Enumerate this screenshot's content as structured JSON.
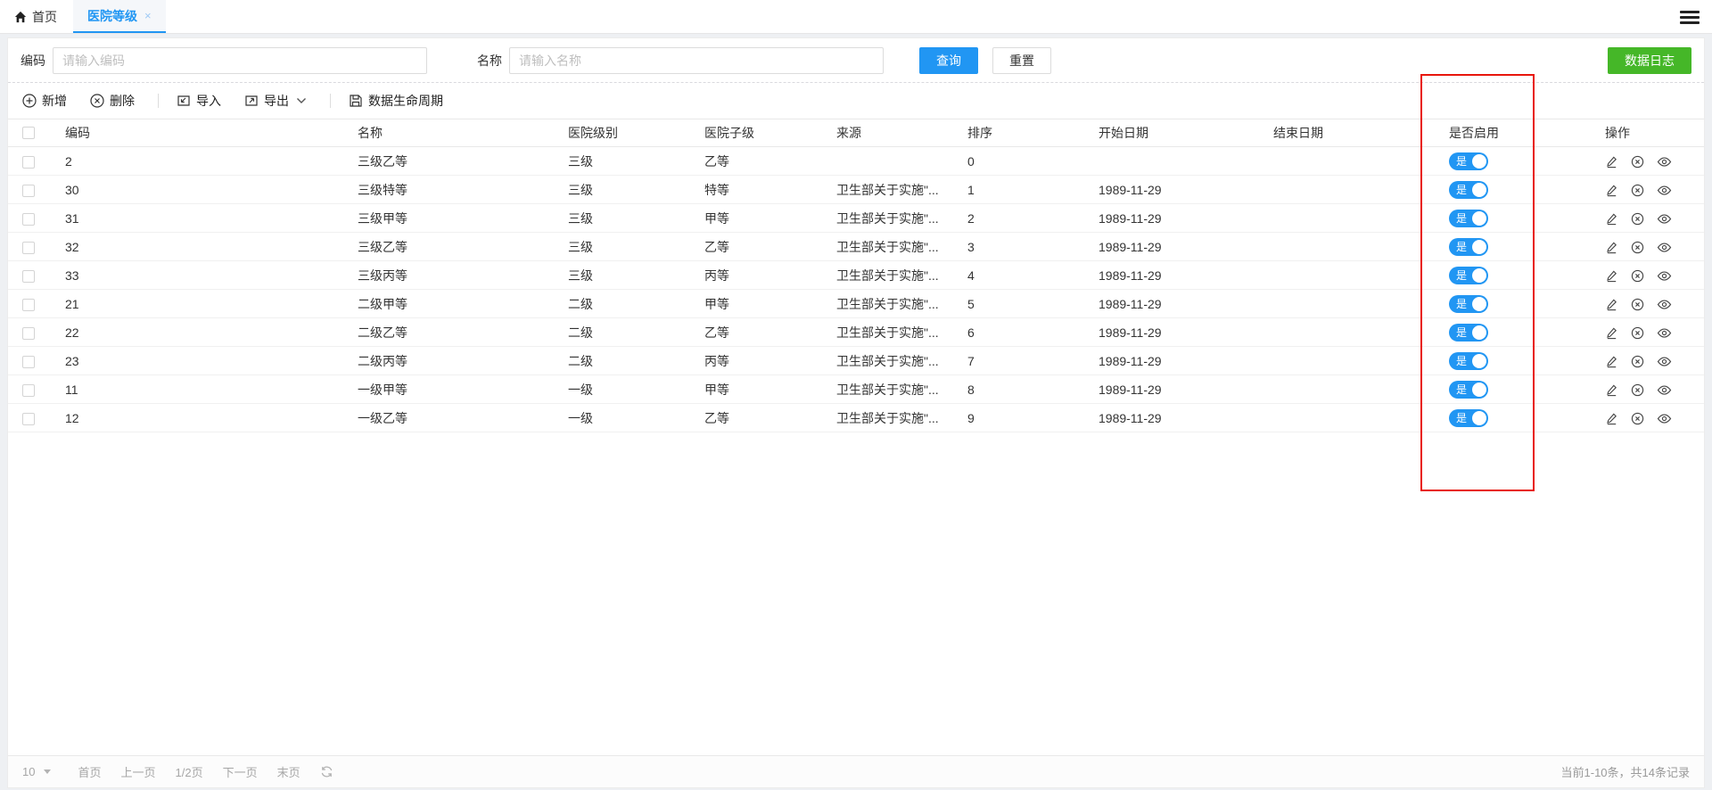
{
  "colors": {
    "accent": "#2196f3",
    "green": "#45b728",
    "red": "#e8160c"
  },
  "tabbar": {
    "home_label": "首页",
    "active_tab": {
      "label": "医院等级",
      "close": "×"
    }
  },
  "search": {
    "code_label": "编码",
    "code_placeholder": "请输入编码",
    "name_label": "名称",
    "name_placeholder": "请输入名称",
    "query_label": "查询",
    "reset_label": "重置",
    "data_log_label": "数据日志"
  },
  "toolbar": {
    "add_label": "新增",
    "delete_label": "删除",
    "import_label": "导入",
    "export_label": "导出",
    "lifecycle_label": "数据生命周期"
  },
  "table": {
    "headers": [
      "编码",
      "名称",
      "医院级别",
      "医院子级",
      "来源",
      "排序",
      "开始日期",
      "结束日期",
      "是否启用",
      "操作"
    ],
    "rows": [
      {
        "code": "2",
        "name": "三级乙等",
        "level": "三级",
        "sublevel": "乙等",
        "source": "",
        "sort": "0",
        "start_date": "",
        "end_date": "",
        "enabled_label": "是"
      },
      {
        "code": "30",
        "name": "三级特等",
        "level": "三级",
        "sublevel": "特等",
        "source": "卫生部关于实施\"...",
        "sort": "1",
        "start_date": "1989-11-29",
        "end_date": "",
        "enabled_label": "是"
      },
      {
        "code": "31",
        "name": "三级甲等",
        "level": "三级",
        "sublevel": "甲等",
        "source": "卫生部关于实施\"...",
        "sort": "2",
        "start_date": "1989-11-29",
        "end_date": "",
        "enabled_label": "是"
      },
      {
        "code": "32",
        "name": "三级乙等",
        "level": "三级",
        "sublevel": "乙等",
        "source": "卫生部关于实施\"...",
        "sort": "3",
        "start_date": "1989-11-29",
        "end_date": "",
        "enabled_label": "是"
      },
      {
        "code": "33",
        "name": "三级丙等",
        "level": "三级",
        "sublevel": "丙等",
        "source": "卫生部关于实施\"...",
        "sort": "4",
        "start_date": "1989-11-29",
        "end_date": "",
        "enabled_label": "是"
      },
      {
        "code": "21",
        "name": "二级甲等",
        "level": "二级",
        "sublevel": "甲等",
        "source": "卫生部关于实施\"...",
        "sort": "5",
        "start_date": "1989-11-29",
        "end_date": "",
        "enabled_label": "是"
      },
      {
        "code": "22",
        "name": "二级乙等",
        "level": "二级",
        "sublevel": "乙等",
        "source": "卫生部关于实施\"...",
        "sort": "6",
        "start_date": "1989-11-29",
        "end_date": "",
        "enabled_label": "是"
      },
      {
        "code": "23",
        "name": "二级丙等",
        "level": "二级",
        "sublevel": "丙等",
        "source": "卫生部关于实施\"...",
        "sort": "7",
        "start_date": "1989-11-29",
        "end_date": "",
        "enabled_label": "是"
      },
      {
        "code": "11",
        "name": "一级甲等",
        "level": "一级",
        "sublevel": "甲等",
        "source": "卫生部关于实施\"...",
        "sort": "8",
        "start_date": "1989-11-29",
        "end_date": "",
        "enabled_label": "是"
      },
      {
        "code": "12",
        "name": "一级乙等",
        "level": "一级",
        "sublevel": "乙等",
        "source": "卫生部关于实施\"...",
        "sort": "9",
        "start_date": "1989-11-29",
        "end_date": "",
        "enabled_label": "是"
      }
    ]
  },
  "pagination": {
    "page_size": "10",
    "first_label": "首页",
    "prev_label": "上一页",
    "current_label": "1/2页",
    "next_label": "下一页",
    "last_label": "末页",
    "summary": "当前1-10条，共14条记录"
  }
}
